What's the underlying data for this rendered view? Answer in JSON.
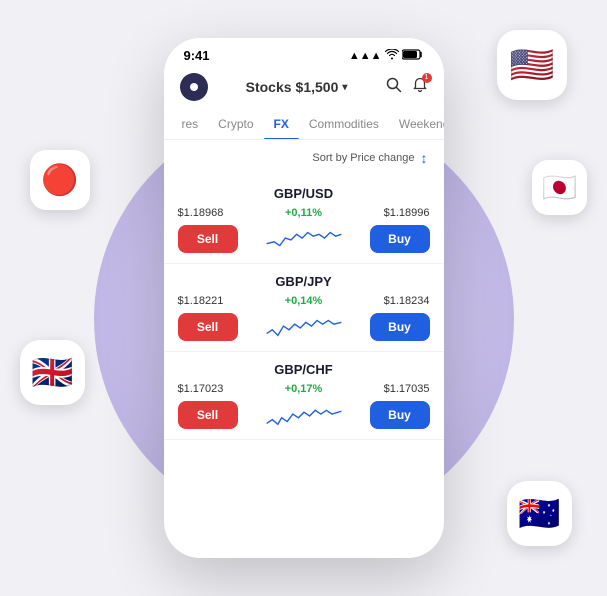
{
  "background": {
    "circle_color": "#c8bfec"
  },
  "status_bar": {
    "time": "9:41",
    "signal": "●●●",
    "wifi": "wifi",
    "battery": "battery"
  },
  "header": {
    "title": "Stocks",
    "balance": "$1,500",
    "chevron": "▾",
    "search_icon": "🔍",
    "notification_icon": "🔔",
    "notification_count": "1"
  },
  "tabs": [
    {
      "label": "res",
      "active": false
    },
    {
      "label": "Crypto",
      "active": false
    },
    {
      "label": "FX",
      "active": true
    },
    {
      "label": "Commodities",
      "active": false
    },
    {
      "label": "Weekend",
      "active": false
    }
  ],
  "sort": {
    "label": "Sort by Price change",
    "icon": "↕"
  },
  "currencies": [
    {
      "pair": "GBP/USD",
      "sell_price": "$1.18968",
      "change": "+0,11%",
      "buy_price": "$1.18996",
      "sell_label": "Sell",
      "buy_label": "Buy"
    },
    {
      "pair": "GBP/JPY",
      "sell_price": "$1.18221",
      "change": "+0,14%",
      "buy_price": "$1.18234",
      "sell_label": "Sell",
      "buy_label": "Buy"
    },
    {
      "pair": "GBP/CHF",
      "sell_price": "$1.17023",
      "change": "+0,17%",
      "buy_price": "$1.17035",
      "sell_label": "Sell",
      "buy_label": "Buy"
    }
  ],
  "flags": {
    "us": "🇺🇸",
    "uk": "🇬🇧",
    "jp": "🇯🇵",
    "au": "🇦🇺",
    "red_circle": "🔴"
  }
}
